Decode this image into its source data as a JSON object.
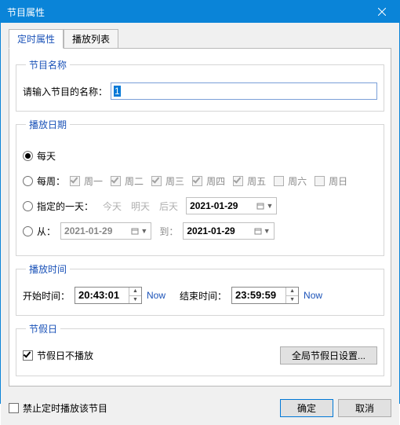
{
  "window": {
    "title": "节目属性"
  },
  "tabs": {
    "timer": "定时属性",
    "playlist": "播放列表"
  },
  "name_group": {
    "legend": "节目名称",
    "label": "请输入节目的名称：",
    "value": "1"
  },
  "date_group": {
    "legend": "播放日期",
    "every_day": "每天",
    "every_week": "每周：",
    "weekdays": [
      "周一",
      "周二",
      "周三",
      "周四",
      "周五",
      "周六",
      "周日"
    ],
    "specific_day": "指定的一天：",
    "quick": {
      "today": "今天",
      "tomorrow": "明天",
      "day_after": "后天"
    },
    "specific_date": "2021-01-29",
    "range_from": "从：",
    "range_to": "到：",
    "range_start": "2021-01-29",
    "range_end": "2021-01-29"
  },
  "time_group": {
    "legend": "播放时间",
    "start_label": "开始时间：",
    "start_value": "20:43:01",
    "end_label": "结束时间：",
    "end_value": "23:59:59",
    "now": "Now"
  },
  "holiday_group": {
    "legend": "节假日",
    "no_play": "节假日不播放",
    "global_btn": "全局节假日设置..."
  },
  "footer": {
    "disable_timer": "禁止定时播放该节目",
    "ok": "确定",
    "cancel": "取消"
  }
}
